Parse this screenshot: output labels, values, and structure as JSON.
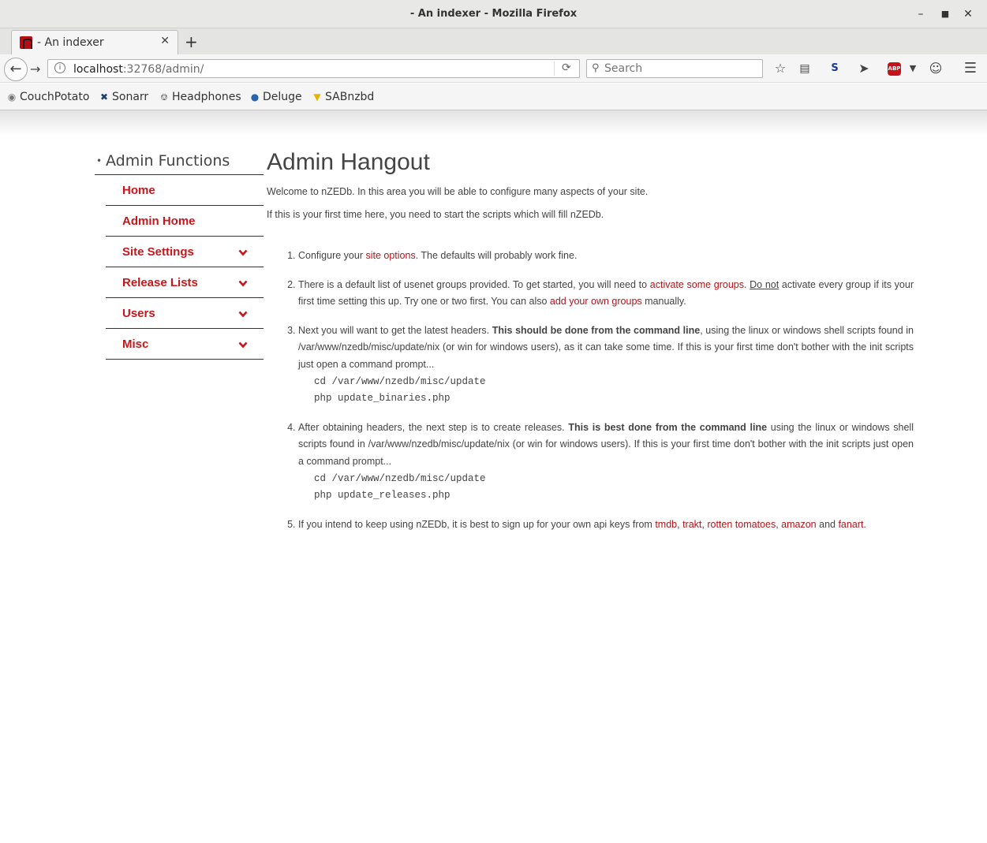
{
  "window": {
    "title": "- An indexer - Mozilla Firefox"
  },
  "tab": {
    "title": "- An indexer"
  },
  "urlbar": {
    "host": "localhost",
    "rest": ":32768/admin/"
  },
  "search": {
    "placeholder": "Search"
  },
  "bookmarks": [
    "CouchPotato",
    "Sonarr",
    "Headphones",
    "Deluge",
    "SABnzbd"
  ],
  "colors": {
    "accent": "#c8171b",
    "link": "#b5151b",
    "text": "#444444"
  },
  "sidebar": {
    "heading": "Admin Functions",
    "items": [
      {
        "label": "Home",
        "expandable": false
      },
      {
        "label": "Admin Home",
        "expandable": false
      },
      {
        "label": "Site Settings",
        "expandable": true
      },
      {
        "label": "Release Lists",
        "expandable": true
      },
      {
        "label": "Users",
        "expandable": true
      },
      {
        "label": "Misc",
        "expandable": true
      }
    ]
  },
  "main": {
    "title": "Admin Hangout",
    "intro1": "Welcome to nZEDb. In this area you will be able to configure many aspects of your site.",
    "intro2": "If this is your first time here, you need to start the scripts which will fill nZEDb.",
    "step1": {
      "a": "Configure your ",
      "link": "site options",
      "b": ". The defaults will probably work fine."
    },
    "step2": {
      "a": "There is a default list of usenet groups provided. To get started, you will need to ",
      "link1": "activate some groups",
      "b": ". ",
      "u": "Do not",
      "c": " activate every group if its your first time setting this up. Try one or two first. You can also ",
      "link2": "add your own groups",
      "d": " manually."
    },
    "step3": {
      "a": "Next you will want to get the latest headers. ",
      "bold": "This should be done from the command line",
      "b": ", using the linux or windows shell scripts found in /var/www/nzedb/misc/update/nix (or win for windows users), as it can take some time. If this is your first time don't bother with the init scripts just open a command prompt...",
      "code1": "cd /var/www/nzedb/misc/update",
      "code2": "php update_binaries.php"
    },
    "step4": {
      "a": "After obtaining headers, the next step is to create releases. ",
      "bold": "This is best done from the command line",
      "b": " using the linux or windows shell scripts found in /var/www/nzedb/misc/update/nix (or win for windows users). If this is your first time don't bother with the init scripts just open a command prompt...",
      "code1": "cd /var/www/nzedb/misc/update",
      "code2": "php update_releases.php"
    },
    "step5": {
      "a": "If you intend to keep using nZEDb, it is best to sign up for your own api keys from ",
      "l1": "tmdb",
      "s1": ", ",
      "l2": "trakt",
      "s2": ", ",
      "l3": "rotten tomatoes",
      "s3": ", ",
      "l4": "amazon",
      "s4": " and ",
      "l5": "fanart",
      "s5": "."
    }
  }
}
